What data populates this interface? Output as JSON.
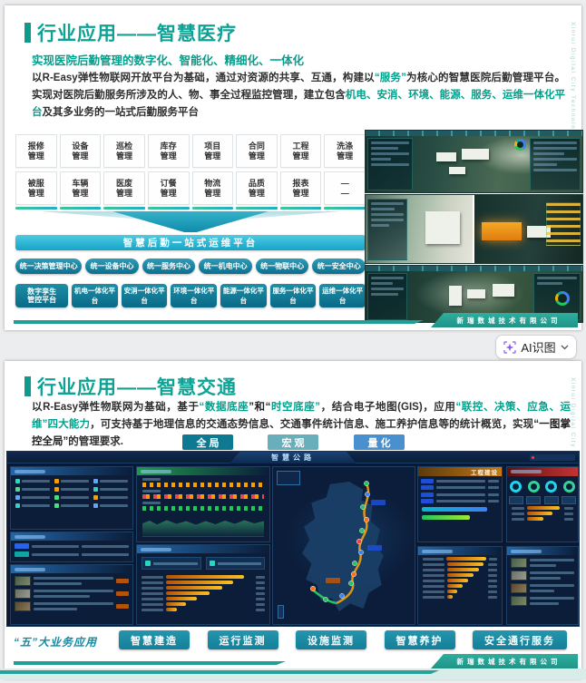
{
  "ai_button": {
    "label": "AI识图"
  },
  "footer": {
    "company": "新瑞数城技术有限公司",
    "side_text": "Xinrui Digital City Technology Co., Ltd"
  },
  "slide1": {
    "title": "行业应用——智慧医疗",
    "subtitle": "实现医院后勤管理的数字化、智能化、精细化、一体化",
    "para": {
      "s1": "以R-Easy弹性物联网开放平台为基础，通过对资源的共享、互通，构建以",
      "s2": "“服务”",
      "s3": "为核心的智慧医院后勤管理平台。实现对医院后勤服务所涉及的人、物、事全过程监控管理，建立包含",
      "s4": "机电、安消、环境、能源、服务、运维一体化平台",
      "s5": "及其多业务的一站式后勤服务平台"
    },
    "grid_row1": [
      {
        "l1": "报修",
        "l2": "管理"
      },
      {
        "l1": "设备",
        "l2": "管理"
      },
      {
        "l1": "巡检",
        "l2": "管理"
      },
      {
        "l1": "库存",
        "l2": "管理"
      },
      {
        "l1": "项目",
        "l2": "管理"
      },
      {
        "l1": "合同",
        "l2": "管理"
      },
      {
        "l1": "工程",
        "l2": "管理"
      },
      {
        "l1": "洗涤",
        "l2": "管理"
      }
    ],
    "grid_row2": [
      {
        "l1": "被服",
        "l2": "管理"
      },
      {
        "l1": "车辆",
        "l2": "管理"
      },
      {
        "l1": "医废",
        "l2": "管理"
      },
      {
        "l1": "订餐",
        "l2": "管理"
      },
      {
        "l1": "物流",
        "l2": "管理"
      },
      {
        "l1": "品质",
        "l2": "管理"
      },
      {
        "l1": "报表",
        "l2": "管理"
      },
      {
        "l1": "—",
        "l2": "—"
      }
    ],
    "banner": "智慧后勤一站式运维平台",
    "centers": [
      "统一决策管理中心",
      "统一设备中心",
      "统一服务中心",
      "统一机电中心",
      "统一物联中心",
      "统一安全中心"
    ],
    "platform_first": {
      "l1": "数字孪生",
      "l2": "管控平台"
    },
    "platforms": [
      "机电一体化平台",
      "安消一体化平台",
      "环境一体化平台",
      "能源一体化平台",
      "服务一体化平台",
      "运维一体化平台"
    ]
  },
  "slide2": {
    "title": "行业应用——智慧交通",
    "para": {
      "s1": "以R-Easy弹性物联网为基础，基于",
      "s2": "“数据底座",
      "s3": "”和“",
      "s4": "时空底座”",
      "s5": "，结合电子地图(GIS)，应用",
      "s6": "“联控、决策、应急、运维”四大能力",
      "s7": "，可支持基于地理信息的交通态势信息、交通事件统计信息、施工养护信息等的统计概览，实现",
      "s8": "“一图掌控全局”",
      "s9": "的管理要求."
    },
    "view_buttons": [
      "全 局",
      "宏 观",
      "量 化"
    ],
    "dashboard": {
      "title": "智慧公路",
      "panel_project": "工程建设"
    },
    "biz_label": "“五”大业务应用",
    "biz_buttons": [
      "智慧建造",
      "运行监测",
      "设施监测",
      "智慧养护",
      "安全通行服务"
    ]
  }
}
